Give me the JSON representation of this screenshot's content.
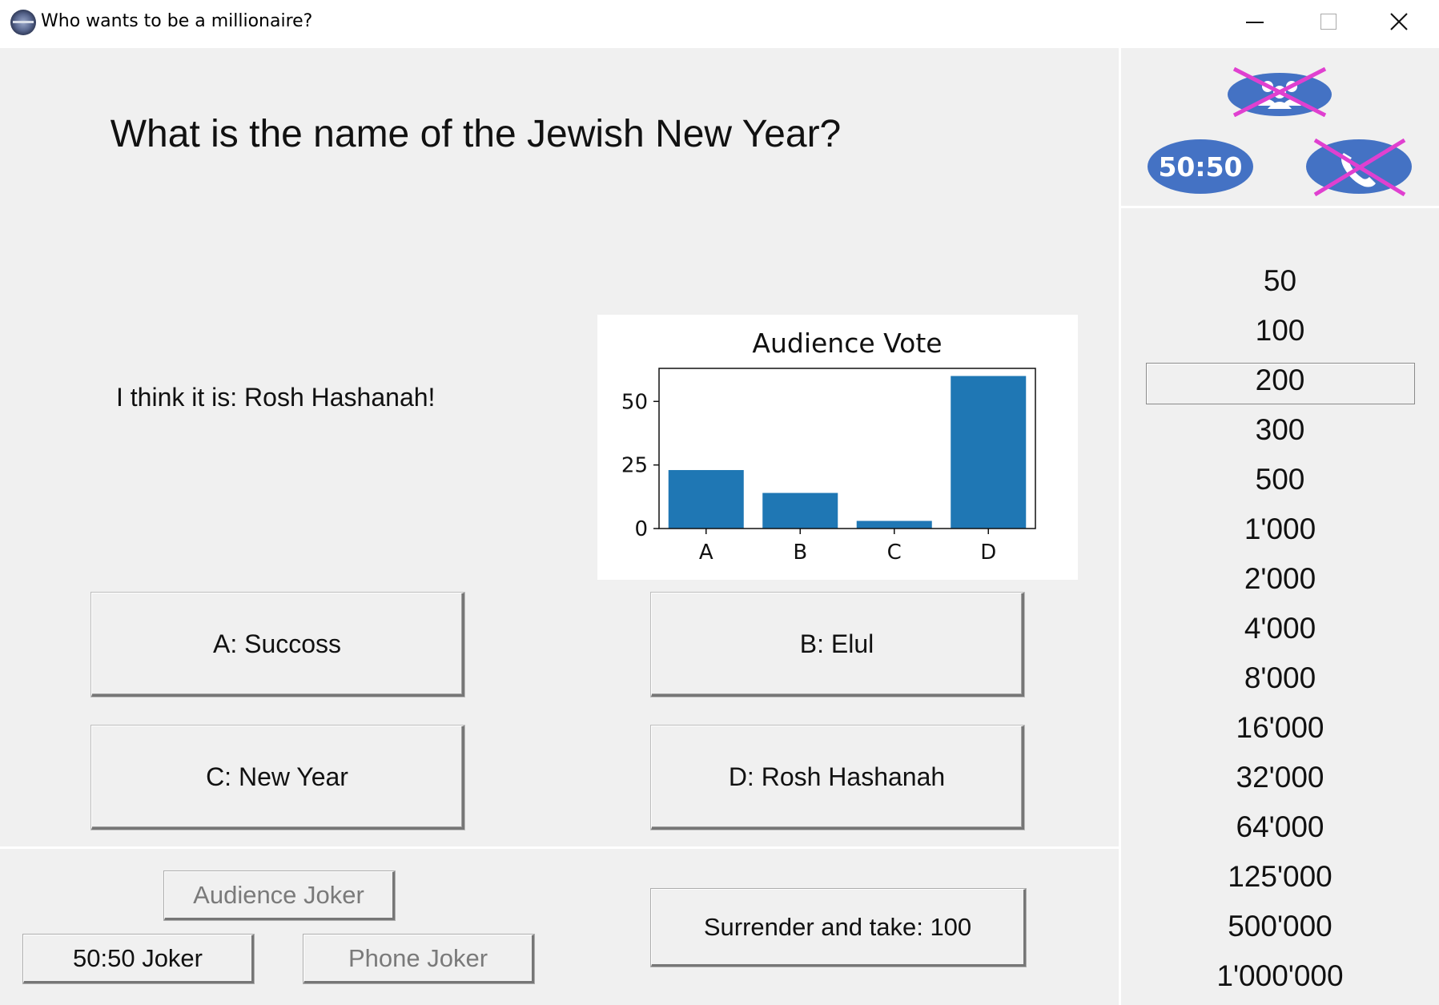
{
  "window": {
    "title": "Who wants to be a millionaire?"
  },
  "question": "What is the name of the Jewish New Year?",
  "hint": "I think it is: Rosh Hashanah!",
  "answers": {
    "a": "A: Succoss",
    "b": "B: Elul",
    "c": "C: New Year",
    "d": "D: Rosh Hashanah"
  },
  "jokers": {
    "audience": "Audience Joker",
    "fifty": "50:50 Joker",
    "phone": "Phone Joker",
    "surrender": "Surrender and take: 100"
  },
  "lifelines": {
    "fifty_label": "50:50",
    "audience_used": true,
    "phone_used": true,
    "fifty_used": false,
    "color": "#4472c4",
    "cross_color": "#e040d0"
  },
  "ladder": {
    "items": [
      "50",
      "100",
      "200",
      "300",
      "500",
      "1'000",
      "2'000",
      "4'000",
      "8'000",
      "16'000",
      "32'000",
      "64'000",
      "125'000",
      "500'000",
      "1'000'000"
    ],
    "current": "200"
  },
  "chart_data": {
    "type": "bar",
    "title": "Audience Vote",
    "categories": [
      "A",
      "B",
      "C",
      "D"
    ],
    "values": [
      23,
      14,
      3,
      60
    ],
    "yticks": [
      0,
      25,
      50
    ],
    "ylim": [
      0,
      63
    ],
    "bar_color": "#1f77b4",
    "grid": false
  }
}
